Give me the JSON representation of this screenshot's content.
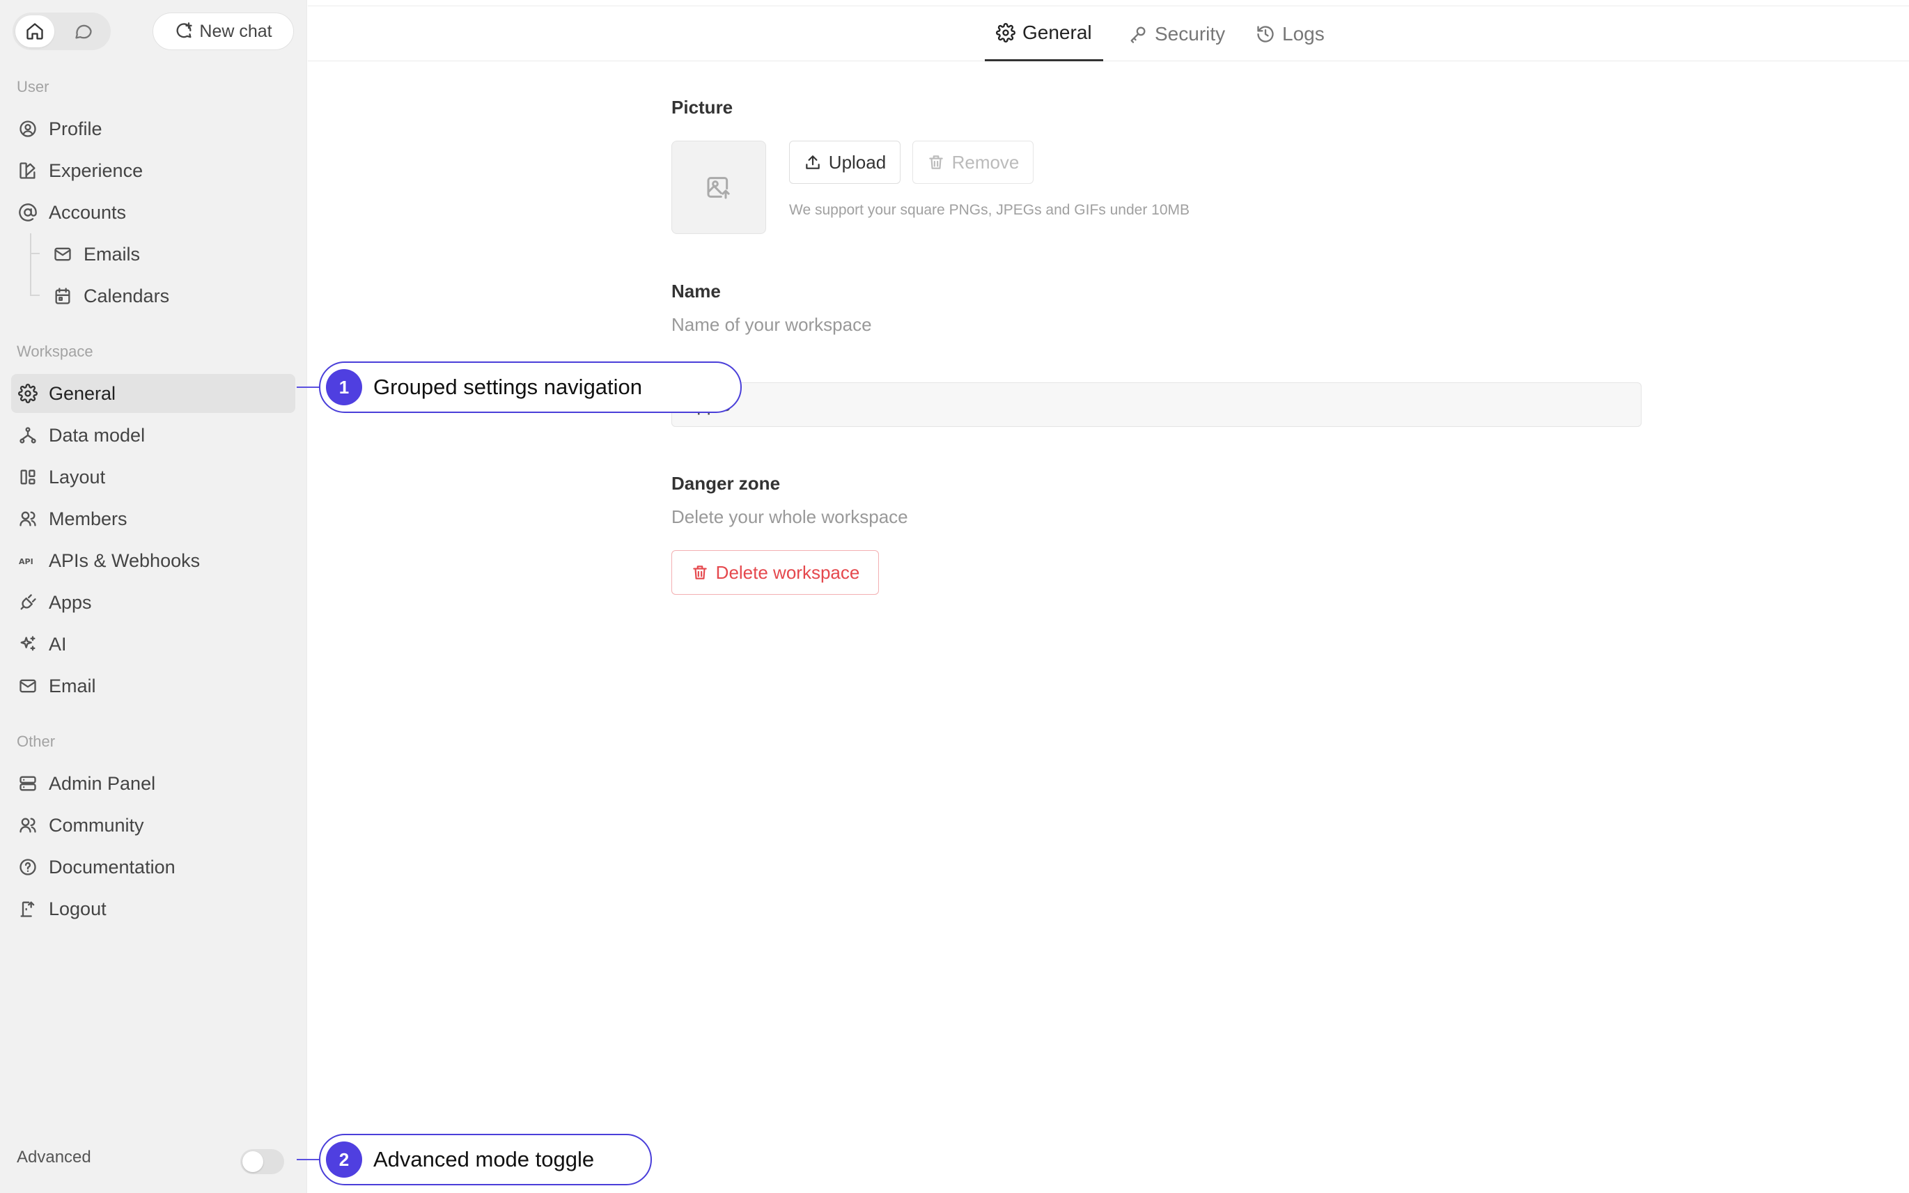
{
  "topbar": {
    "home_icon": "home-icon",
    "chat_icon": "chat-bubble-icon",
    "new_chat_label": "New chat"
  },
  "sidebar": {
    "sections": {
      "user": "User",
      "workspace": "Workspace",
      "other": "Other"
    },
    "user_items": [
      {
        "label": "Profile",
        "icon": "user-circle-icon"
      },
      {
        "label": "Experience",
        "icon": "palette-icon"
      },
      {
        "label": "Accounts",
        "icon": "at-sign-icon"
      },
      {
        "label": "Emails",
        "icon": "mail-icon"
      },
      {
        "label": "Calendars",
        "icon": "calendar-icon"
      }
    ],
    "workspace_items": [
      {
        "label": "General",
        "icon": "gear-icon",
        "active": true
      },
      {
        "label": "Data model",
        "icon": "hierarchy-icon"
      },
      {
        "label": "Layout",
        "icon": "layout-icon"
      },
      {
        "label": "Members",
        "icon": "users-icon"
      },
      {
        "label": "APIs & Webhooks",
        "icon": "api-icon"
      },
      {
        "label": "Apps",
        "icon": "plug-icon"
      },
      {
        "label": "AI",
        "icon": "sparkles-icon"
      },
      {
        "label": "Email",
        "icon": "mail-icon"
      }
    ],
    "other_items": [
      {
        "label": "Admin Panel",
        "icon": "server-icon"
      },
      {
        "label": "Community",
        "icon": "users-icon"
      },
      {
        "label": "Documentation",
        "icon": "help-circle-icon"
      },
      {
        "label": "Logout",
        "icon": "logout-icon"
      }
    ],
    "advanced_label": "Advanced",
    "advanced_enabled": false
  },
  "tabs": [
    {
      "label": "General",
      "icon": "gear-icon",
      "active": true
    },
    {
      "label": "Security",
      "icon": "key-icon",
      "active": false
    },
    {
      "label": "Logs",
      "icon": "history-icon",
      "active": false
    }
  ],
  "picture": {
    "title": "Picture",
    "upload_label": "Upload",
    "remove_label": "Remove",
    "hint": "We support your square PNGs, JPEGs and GIFs under 10MB"
  },
  "name": {
    "title": "Name",
    "description": "Name of your workspace",
    "value": "Apple"
  },
  "danger": {
    "title": "Danger zone",
    "description": "Delete your whole workspace",
    "delete_label": "Delete workspace"
  },
  "callouts": [
    {
      "number": "1",
      "text": "Grouped settings navigation"
    },
    {
      "number": "2",
      "text": "Advanced mode toggle"
    }
  ],
  "colors": {
    "accent": "#4f3fe0",
    "danger": "#e5484d",
    "sidebar_bg": "#f1f1f1"
  }
}
